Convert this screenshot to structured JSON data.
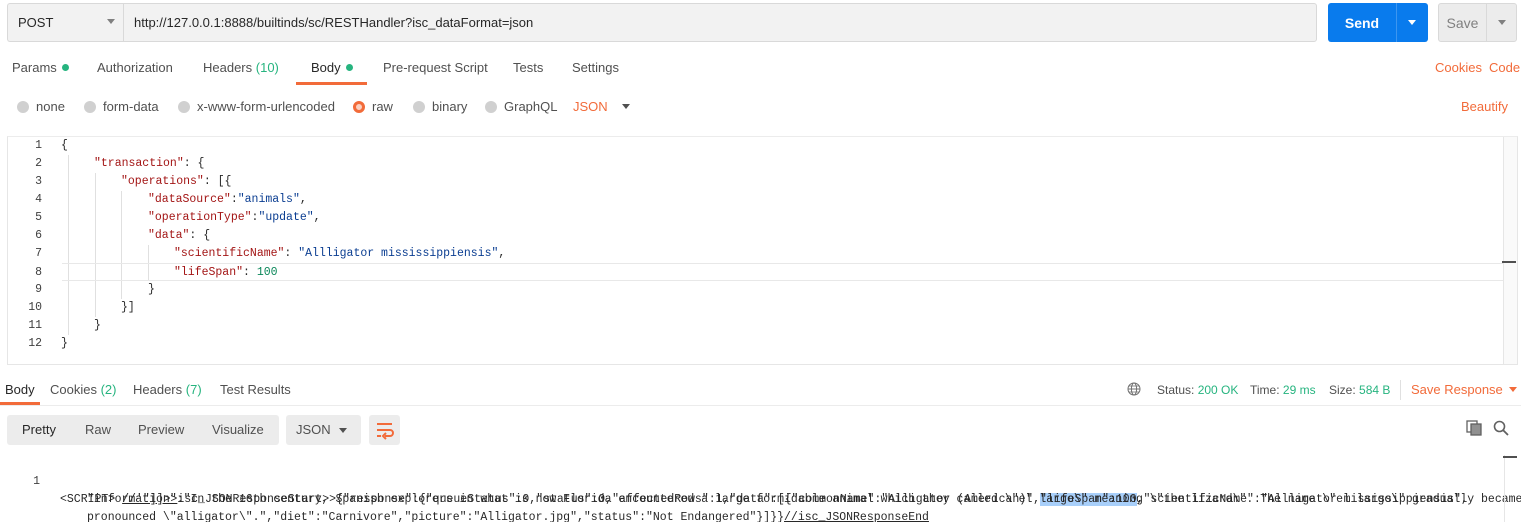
{
  "request": {
    "method": "POST",
    "url": "http://127.0.0.1:8888/builtinds/sc/RESTHandler?isc_dataFormat=json",
    "send_label": "Send",
    "save_label": "Save"
  },
  "request_tabs": {
    "params": "Params",
    "authorization": "Authorization",
    "headers": "Headers",
    "headers_count": "(10)",
    "body": "Body",
    "prerequest": "Pre-request Script",
    "tests": "Tests",
    "settings": "Settings",
    "cookies": "Cookies",
    "code": "Code",
    "status_dot_color": "#26b47f"
  },
  "body_types": {
    "none": "none",
    "form_data": "form-data",
    "urlencoded": "x-www-form-urlencoded",
    "raw": "raw",
    "binary": "binary",
    "graphql": "GraphQL",
    "format": "JSON",
    "beautify": "Beautify",
    "selected": "raw"
  },
  "editor": {
    "line_numbers": [
      "1",
      "2",
      "3",
      "4",
      "5",
      "6",
      "7",
      "8",
      "9",
      "10",
      "11",
      "12"
    ],
    "l1": "{",
    "l2_key": "\"transaction\"",
    "l2_rest": ": {",
    "l3_key": "\"operations\"",
    "l3_rest": ": [{",
    "l4_key": "\"dataSource\"",
    "l4_sep": ":",
    "l4_val": "\"animals\"",
    "l4_end": ",",
    "l5_key": "\"operationType\"",
    "l5_sep": ":",
    "l5_val": "\"update\"",
    "l5_end": ",",
    "l6_key": "\"data\"",
    "l6_rest": ": {",
    "l7_key": "\"scientificName\"",
    "l7_sep": ": ",
    "l7_val": "\"Allligator mississippiensis\"",
    "l7_end": ",",
    "l8_key": "\"lifeSpan\"",
    "l8_sep": ": ",
    "l8_val": "100",
    "l9": "}",
    "l10": "}]",
    "l11": "}",
    "l12": "}"
  },
  "response_tabs": {
    "body": "Body",
    "cookies": "Cookies",
    "cookies_count": "(2)",
    "headers": "Headers",
    "headers_count": "(7)",
    "test_results": "Test Results",
    "status_label": "Status:",
    "status_value": "200 OK",
    "time_label": "Time:",
    "time_value": "29 ms",
    "size_label": "Size:",
    "size_value": "584 B",
    "save_response": "Save Response"
  },
  "response_toolbar": {
    "pretty": "Pretty",
    "raw": "Raw",
    "preview": "Preview",
    "visualize": "Visualize",
    "format": "JSON"
  },
  "response_body": {
    "line_number": "1",
    "line1_a": "<SCRIPT> ",
    "line1_b": "//'\"]]>>",
    "line1_c": "isc_JSONResponseStart>>{\"response\":{\"queueStatus\":0,\"status\":0,\"affectedRows\":1,\"data\":[{\"commonName\":\"Alligator (American)\",",
    "line1_hl": "\"lifeSpan\":100",
    "line1_d": ",\"scientificName\":\"Allligator mississippiensis\",",
    "line2": "\"information\":\"In the 16th century, Spanish explorers in what is now Florida encountered a large formidable animal which they called \\\"el largo\\\" meaning \\\"the lizard\\\". The name \\\"el largo\\\" gradually became",
    "line3_a": "pronounced \\\"alligator\\\".\",\"diet\":\"Carnivore\",\"picture\":\"Alligator.jpg\",\"status\":\"Not Endangered\"}]}}",
    "line3_b": "//isc_JSONResponseEnd"
  },
  "colors": {
    "accent": "#f26b3a",
    "send": "#097bed",
    "success": "#26b47f"
  }
}
